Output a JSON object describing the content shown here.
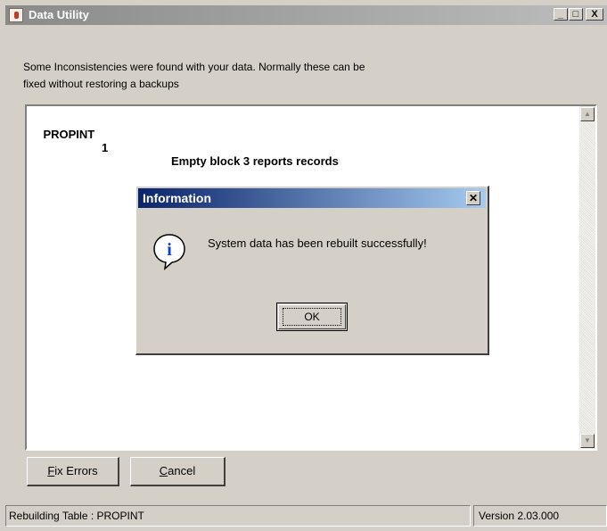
{
  "window": {
    "title": "Data Utility",
    "minimize_glyph": "_",
    "maximize_glyph": "□",
    "close_glyph": "X"
  },
  "intro": {
    "line1": "Some Inconsistencies were found with your data.  Normally these can be",
    "line2": "fixed without restoring a backups"
  },
  "errors": {
    "rows": [
      {
        "table": "PROPINT",
        "number": "1",
        "message": "Empty block 3 reports records"
      }
    ]
  },
  "buttons": {
    "fix_errors_key": "F",
    "fix_errors_rest": "ix Errors",
    "cancel_key": "C",
    "cancel_rest": "ancel"
  },
  "status": {
    "left": "Rebuilding Table : PROPINT",
    "right": "Version 2.03.000"
  },
  "dialog": {
    "title": "Information",
    "close_glyph": "✕",
    "message": "System data has been rebuilt successfully!",
    "ok_label": "OK",
    "icon": "information-icon",
    "icon_glyph": "i"
  },
  "colors": {
    "dialog_title_start": "#0a246a",
    "dialog_title_end": "#a6caf0",
    "info_icon": "#0a3fd0"
  }
}
